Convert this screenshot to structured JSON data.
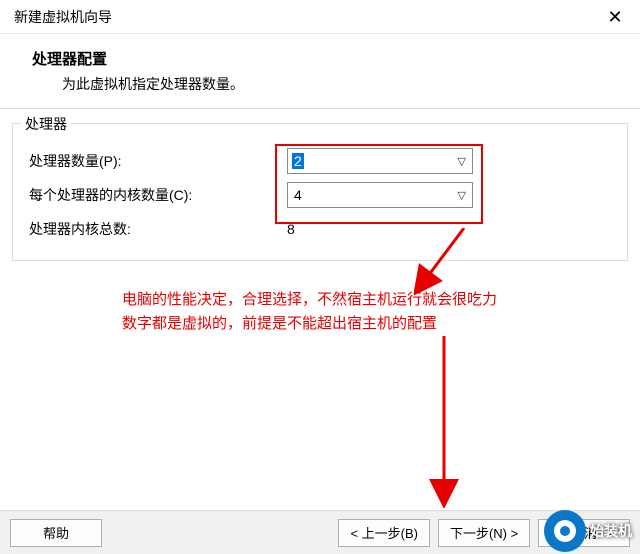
{
  "window": {
    "title": "新建虚拟机向导"
  },
  "header": {
    "heading": "处理器配置",
    "sub": "为此虚拟机指定处理器数量。"
  },
  "group": {
    "label": "处理器",
    "rows": {
      "proc_count_label": "处理器数量(P):",
      "proc_count_value": "2",
      "cores_per_label": "每个处理器的内核数量(C):",
      "cores_per_value": "4",
      "total_label": "处理器内核总数:",
      "total_value": "8"
    }
  },
  "annotation": {
    "line1": "电脑的性能决定，合理选择，不然宿主机运行就会很吃力",
    "line2": "数字都是虚拟的，前提是不能超出宿主机的配置"
  },
  "buttons": {
    "help": "帮助",
    "back": "< 上一步(B)",
    "next": "下一步(N) >",
    "cancel": "取消"
  },
  "watermark": {
    "text": "始装机"
  }
}
